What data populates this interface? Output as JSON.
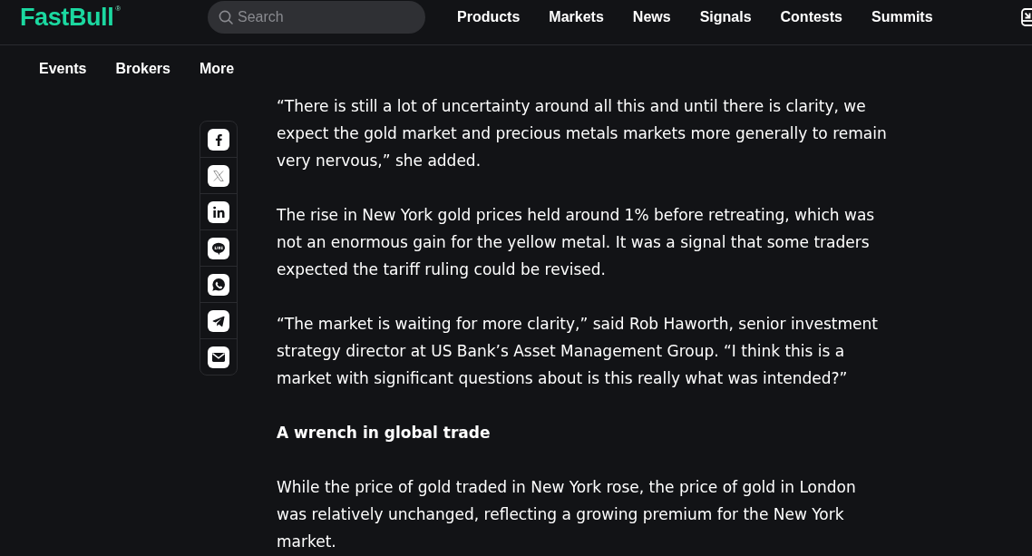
{
  "header": {
    "logo": "FastBull$^{®}$",
    "search": {
      "placeholder": "Search"
    },
    "nav": [
      "Products",
      "Markets",
      "News",
      "Signals",
      "Contests",
      "Summits"
    ]
  },
  "subnav": [
    "Events",
    "Brokers",
    "More"
  ],
  "share": [
    {
      "kind": "facebook"
    },
    {
      "kind": "x"
    },
    {
      "kind": "linkedin"
    },
    {
      "kind": "line"
    },
    {
      "kind": "whatsapp"
    },
    {
      "kind": "telegram"
    },
    {
      "kind": "email"
    }
  ],
  "article": [
    {
      "kind": "paragraph",
      "text": "“There is still a lot of uncertainty around all this and until there is clarity, we expect the gold market and precious metals markets more generally to remain very nervous,” she added."
    },
    {
      "kind": "paragraph",
      "text": "The rise in New York gold prices held around 1% before retreating, which was not an enormous gain for the yellow metal. It was a signal that some traders expected the tariff ruling could be revised."
    },
    {
      "kind": "paragraph",
      "text": "“The market is waiting for more clarity,” said Rob Haworth, senior investment strategy director at US Bank’s Asset Management Group. “I think this is a market with significant questions about is this really what was intended?”"
    },
    {
      "kind": "heading",
      "text": "A wrench in global trade"
    },
    {
      "kind": "paragraph",
      "text": "While the price of gold traded in New York rose, the price of gold in London was relatively unchanged, reflecting a growing premium for the New York market."
    }
  ]
}
